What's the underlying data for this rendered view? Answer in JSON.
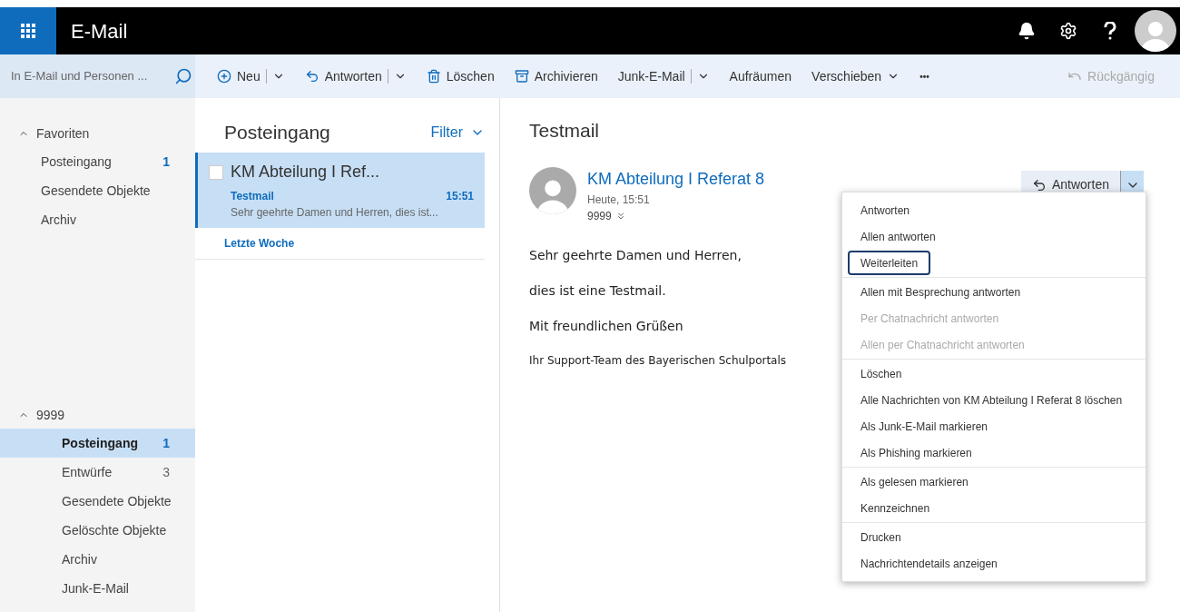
{
  "app": {
    "title": "E-Mail"
  },
  "search": {
    "placeholder": "In E-Mail und Personen ..."
  },
  "toolbar": [
    {
      "kind": "new",
      "label": "Neu",
      "split": true,
      "menu": true
    },
    {
      "kind": "reply",
      "label": "Antworten",
      "split": true,
      "menu": true
    },
    {
      "kind": "delete",
      "label": "Löschen",
      "split": false,
      "menu": false
    },
    {
      "kind": "archive",
      "label": "Archivieren",
      "split": false,
      "menu": false
    },
    {
      "kind": "plain",
      "label": "Junk-E-Mail",
      "split": true,
      "menu": true
    },
    {
      "kind": "plain",
      "label": "Aufräumen",
      "split": false,
      "menu": false
    },
    {
      "kind": "plain",
      "label": "Verschieben",
      "split": false,
      "menu": true
    },
    {
      "kind": "more",
      "label": "•••",
      "split": false,
      "menu": false
    }
  ],
  "undo": {
    "label": "Rückgängig",
    "disabled": true
  },
  "sidebar": {
    "sections": [
      {
        "title": "Favoriten",
        "expanded": true,
        "items": [
          {
            "label": "Posteingang",
            "count": "1",
            "count_highlighted": true,
            "selected": false
          },
          {
            "label": "Gesendete Objekte",
            "selected": false
          },
          {
            "label": "Archiv",
            "selected": false
          }
        ]
      },
      {
        "title": "9999",
        "expanded": true,
        "items": [
          {
            "label": "Posteingang",
            "count": "1",
            "count_highlighted": true,
            "selected": true
          },
          {
            "label": "Entwürfe",
            "count": "3",
            "count_highlighted": false,
            "selected": false
          },
          {
            "label": "Gesendete Objekte",
            "selected": false
          },
          {
            "label": "Gelöschte Objekte",
            "selected": false
          },
          {
            "label": "Archiv",
            "selected": false
          },
          {
            "label": "Junk-E-Mail",
            "selected": false
          }
        ]
      }
    ]
  },
  "mail_list": {
    "title": "Posteingang",
    "filter": "Filter",
    "messages": [
      {
        "sender": "KM Abteilung I Ref...",
        "subject": "Testmail",
        "time": "15:51",
        "preview": "Sehr geehrte Damen und Herren, dies ist...",
        "selected": true,
        "checked": false
      }
    ],
    "group": "Letzte Woche"
  },
  "reading": {
    "subject": "Testmail",
    "sender": "KM Abteilung I Referat 8",
    "date": "Heute, 15:51",
    "recipient": "9999",
    "reply": "Antworten",
    "body": [
      "Sehr geehrte Damen und Herren,",
      "dies ist eine Testmail.",
      "Mit freundlichen Grüßen",
      "Ihr Support-Team des Bayerischen Schulportals"
    ]
  },
  "menu": [
    {
      "label": "Antworten",
      "disabled": false,
      "focused": false,
      "separator_after": false
    },
    {
      "label": "Allen antworten",
      "disabled": false,
      "focused": false,
      "separator_after": false
    },
    {
      "label": "Weiterleiten",
      "disabled": false,
      "focused": true,
      "separator_after": true
    },
    {
      "label": "Allen mit Besprechung antworten",
      "disabled": false,
      "focused": false,
      "separator_after": false
    },
    {
      "label": "Per Chatnachricht antworten",
      "disabled": true,
      "focused": false,
      "separator_after": false
    },
    {
      "label": "Allen per Chatnachricht antworten",
      "disabled": true,
      "focused": false,
      "separator_after": true
    },
    {
      "label": "Löschen",
      "disabled": false,
      "focused": false,
      "separator_after": false
    },
    {
      "label": "Alle Nachrichten von KM Abteilung I Referat 8 löschen",
      "disabled": false,
      "focused": false,
      "separator_after": false
    },
    {
      "label": "Als Junk-E-Mail markieren",
      "disabled": false,
      "focused": false,
      "separator_after": false
    },
    {
      "label": "Als Phishing markieren",
      "disabled": false,
      "focused": false,
      "separator_after": true
    },
    {
      "label": "Als gelesen markieren",
      "disabled": false,
      "focused": false,
      "separator_after": false
    },
    {
      "label": "Kennzeichnen",
      "disabled": false,
      "focused": false,
      "separator_after": true
    },
    {
      "label": "Drucken",
      "disabled": false,
      "focused": false,
      "separator_after": false
    },
    {
      "label": "Nachrichtendetails anzeigen",
      "disabled": false,
      "focused": false,
      "separator_after": false
    }
  ]
}
